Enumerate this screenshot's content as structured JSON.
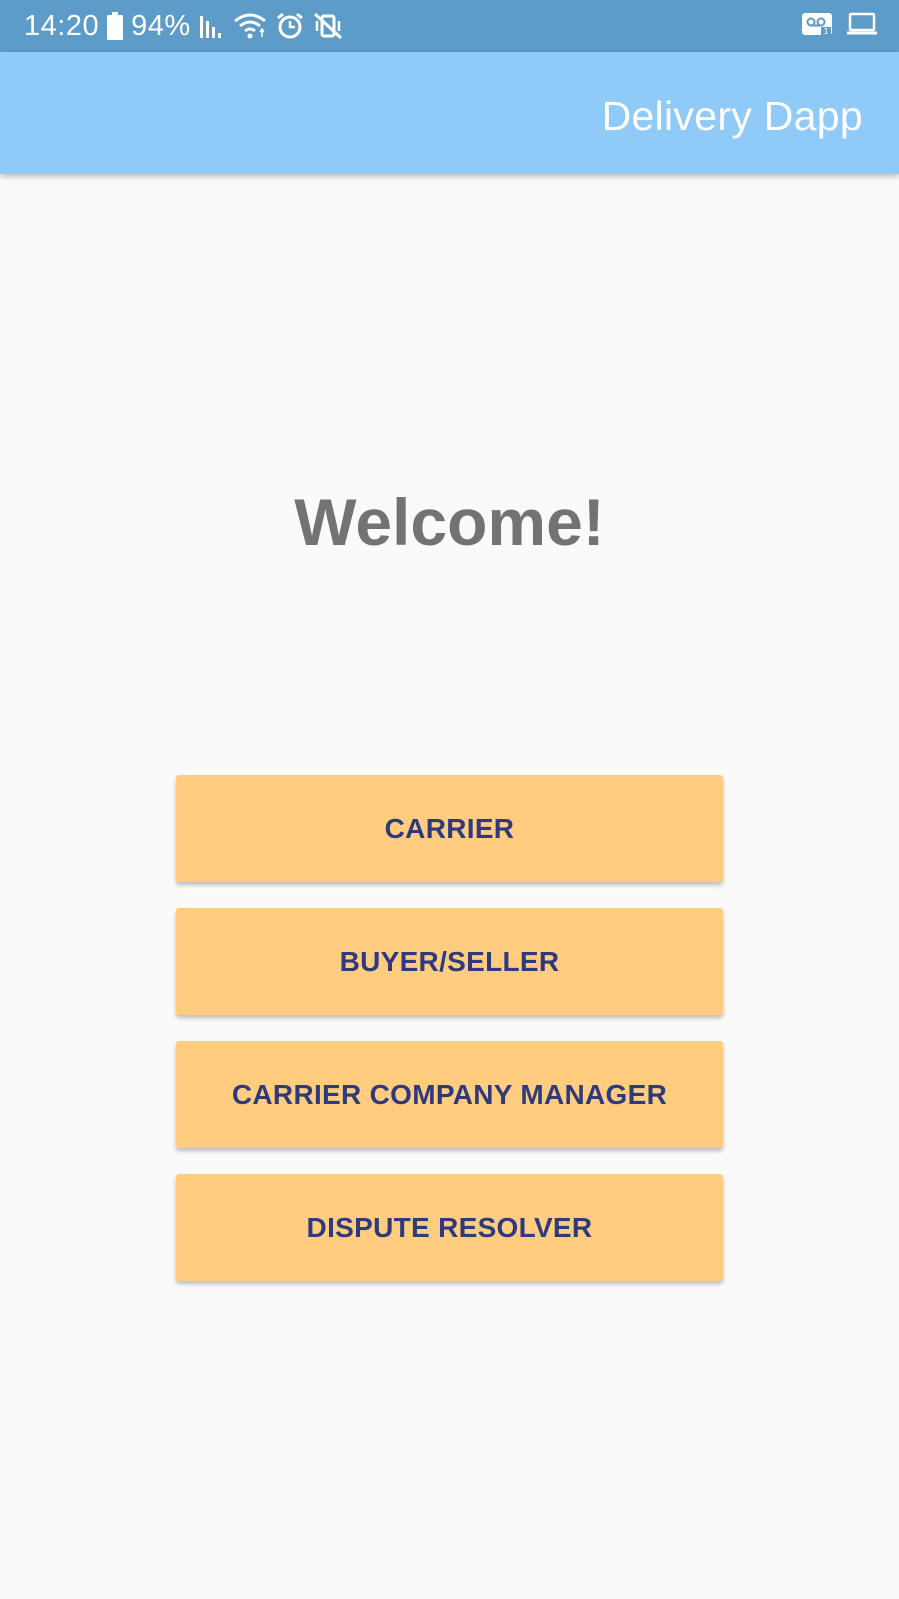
{
  "status_bar": {
    "time": "14:20",
    "battery_percent": "94%",
    "icons": [
      "battery-icon",
      "signal-icon",
      "wifi-icon",
      "alarm-icon",
      "vibrate-icon",
      "voicemail-icon",
      "laptop-icon"
    ]
  },
  "app_bar": {
    "title": "Delivery Dapp"
  },
  "main": {
    "welcome_text": "Welcome!",
    "buttons": [
      {
        "label": "CARRIER"
      },
      {
        "label": "BUYER/SELLER"
      },
      {
        "label": "CARRIER COMPANY MANAGER"
      },
      {
        "label": "DISPUTE RESOLVER"
      }
    ]
  },
  "colors": {
    "status_bar": "#5d9bc8",
    "app_bar": "#90caf9",
    "button_bg": "#ffcc80",
    "button_text": "#2e3a7c",
    "welcome_text": "#737373",
    "background": "#fafafa"
  }
}
